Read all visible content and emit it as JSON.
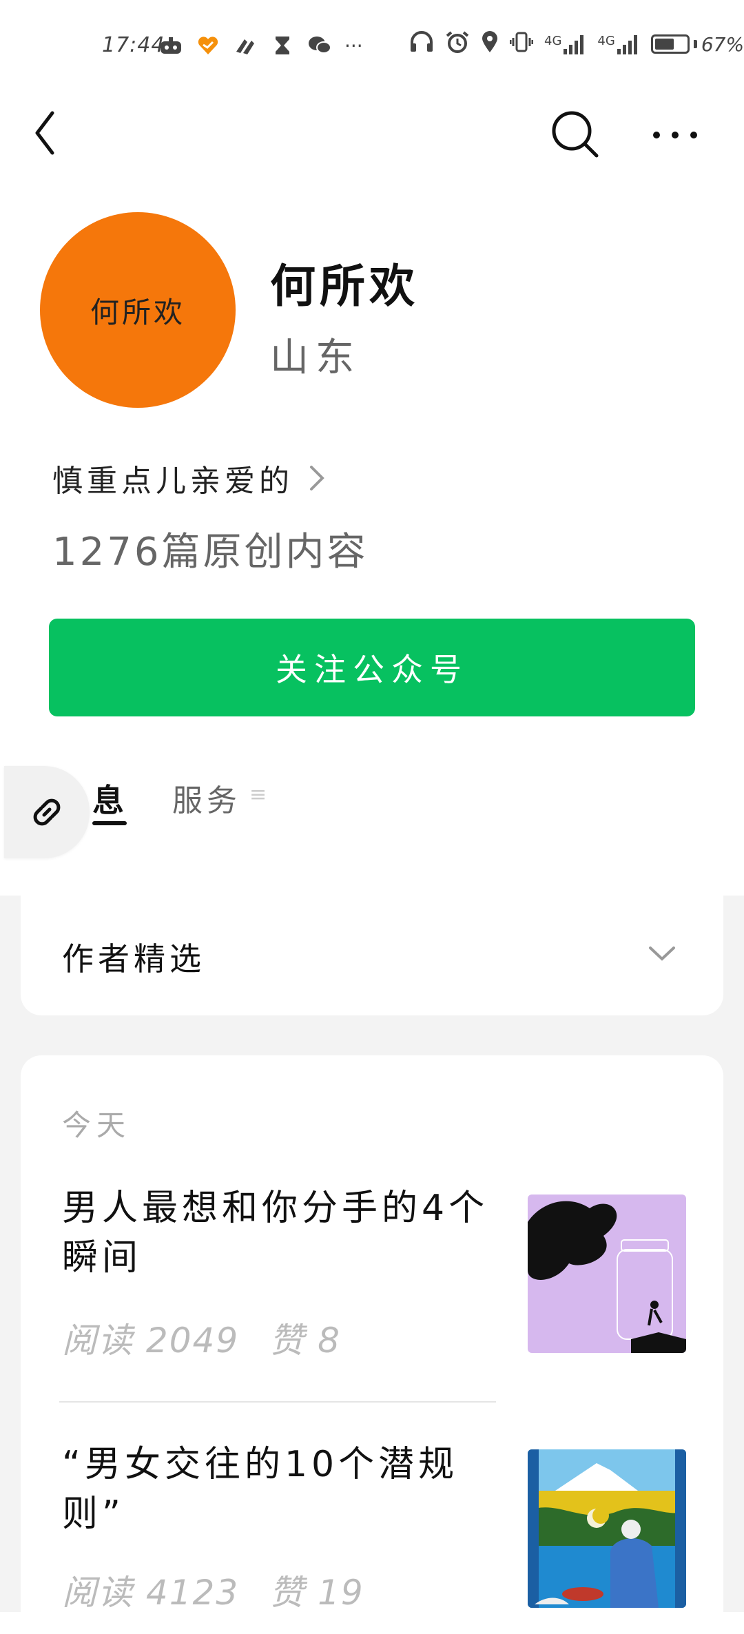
{
  "status_bar": {
    "time": "17:44",
    "app_icons": [
      "game-icon",
      "heart-icon",
      "tiktok-icon",
      "hourglass-icon",
      "wechat-icon"
    ],
    "more": "···",
    "network_1": "4G",
    "network_2": "4G",
    "battery_percent": 67,
    "battery_label": "67%"
  },
  "nav": {
    "back_icon": "chevron-left-icon",
    "search_icon": "search-icon",
    "more_icon": "more-dots-icon"
  },
  "profile": {
    "avatar_text": "何所欢",
    "avatar_color": "#f5770b",
    "name": "何所欢",
    "region": "山东",
    "bio": "慎重点儿亲爱的",
    "content_count": "1276篇原创内容"
  },
  "follow": {
    "label": "关注公众号",
    "color": "#07c160"
  },
  "tabs": {
    "messages": "息",
    "services": "服务",
    "services_mark": "≡"
  },
  "selected": {
    "title": "作者精选"
  },
  "feed": {
    "date_label": "今天",
    "articles": [
      {
        "title": "男人最想和你分手的4个瞬间",
        "read_label": "阅读",
        "read_count": "2049",
        "like_label": "赞",
        "like_count": "8"
      },
      {
        "title": "“男女交往的10个潜规则”",
        "read_label": "阅读",
        "read_count": "4123",
        "like_label": "赞",
        "like_count": "19"
      }
    ]
  }
}
